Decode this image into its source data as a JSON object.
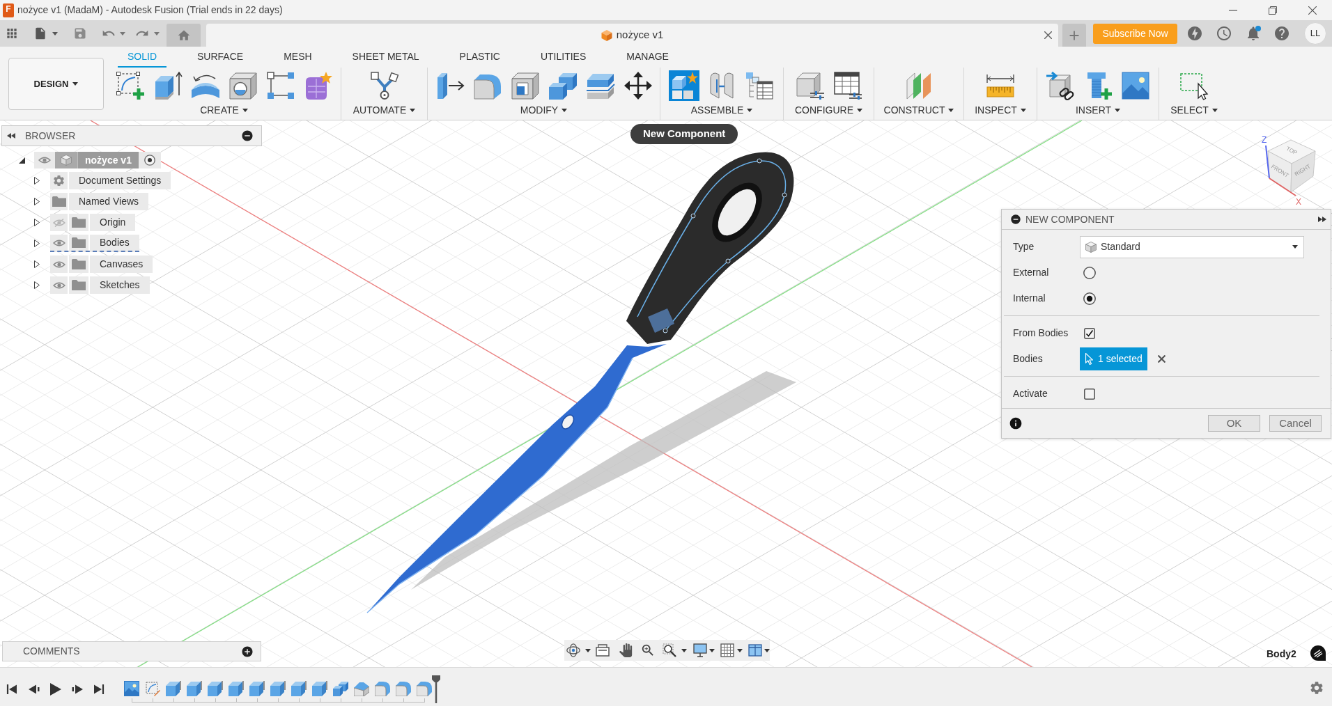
{
  "window": {
    "logo_letter": "F",
    "title": "nożyce v1 (MadaM) - Autodesk Fusion (Trial ends in 22 days)"
  },
  "tab_bar": {
    "document_title": "nożyce v1",
    "subscribe_button": "Subscribe Now",
    "unread_notifications": true,
    "avatar": "LL"
  },
  "toolbar": {
    "workspace": "DESIGN",
    "tabs": [
      {
        "label": "SOLID",
        "selected": true
      },
      {
        "label": "SURFACE",
        "selected": false
      },
      {
        "label": "MESH",
        "selected": false
      },
      {
        "label": "SHEET METAL",
        "selected": false
      },
      {
        "label": "PLASTIC",
        "selected": false
      },
      {
        "label": "UTILITIES",
        "selected": false
      },
      {
        "label": "MANAGE",
        "selected": false
      }
    ],
    "groups": [
      {
        "label": "CREATE",
        "tools": [
          {
            "kind": "sketch",
            "active": false
          },
          {
            "kind": "extrude",
            "active": false
          },
          {
            "kind": "revolve",
            "active": false
          },
          {
            "kind": "hole",
            "active": false
          },
          {
            "kind": "pattern",
            "active": false
          },
          {
            "kind": "form",
            "active": false
          }
        ]
      },
      {
        "label": "AUTOMATE",
        "tools": [
          {
            "kind": "automate",
            "active": false
          }
        ]
      },
      {
        "label": "MODIFY",
        "tools": [
          {
            "kind": "presspull",
            "active": false
          },
          {
            "kind": "fillet",
            "active": false
          },
          {
            "kind": "shell",
            "active": false
          },
          {
            "kind": "combine",
            "active": false
          },
          {
            "kind": "split",
            "active": false
          },
          {
            "kind": "move",
            "active": false
          }
        ]
      },
      {
        "label": "ASSEMBLE",
        "tools": [
          {
            "kind": "component",
            "active": true
          },
          {
            "kind": "joint",
            "active": false
          },
          {
            "kind": "table",
            "active": false
          }
        ]
      },
      {
        "label": "CONFIGURE",
        "tools": [
          {
            "kind": "configure",
            "active": false
          },
          {
            "kind": "parameters",
            "active": false
          }
        ]
      },
      {
        "label": "CONSTRUCT",
        "tools": [
          {
            "kind": "plane",
            "active": false
          }
        ]
      },
      {
        "label": "INSPECT",
        "tools": [
          {
            "kind": "measure",
            "active": false
          }
        ]
      },
      {
        "label": "INSERT",
        "tools": [
          {
            "kind": "derive",
            "active": false
          },
          {
            "kind": "fastener",
            "active": false
          },
          {
            "kind": "canvas",
            "active": false
          }
        ]
      },
      {
        "label": "SELECT",
        "tools": [
          {
            "kind": "select",
            "active": false
          }
        ]
      }
    ]
  },
  "tooltip": "New Component",
  "browser": {
    "title": "BROWSER",
    "root": {
      "name": "nożyce v1",
      "expanded": true,
      "visible": true,
      "active": true,
      "children": [
        {
          "name": "Document Settings",
          "kind": "settings",
          "expanded": false,
          "selected": false
        },
        {
          "name": "Named Views",
          "kind": "views",
          "expanded": false,
          "selected": false
        },
        {
          "name": "Origin",
          "kind": "folder",
          "visible": false,
          "expanded": false,
          "selected": false
        },
        {
          "name": "Bodies",
          "kind": "folder",
          "visible": true,
          "expanded": false,
          "selected": true
        },
        {
          "name": "Canvases",
          "kind": "folder",
          "visible": true,
          "expanded": false,
          "selected": false
        },
        {
          "name": "Sketches",
          "kind": "folder",
          "visible": true,
          "expanded": false,
          "selected": false
        }
      ]
    }
  },
  "view_cube": {
    "faces": [
      "TOP",
      "FRONT",
      "RIGHT"
    ],
    "axes": [
      "Z",
      "X"
    ]
  },
  "dialog": {
    "title": "NEW COMPONENT",
    "sections": [
      {
        "rows": [
          {
            "kind": "dropdown",
            "label": "Type",
            "value": "Standard"
          },
          {
            "kind": "radio",
            "label": "External",
            "selected": false
          },
          {
            "kind": "radio",
            "label": "Internal",
            "selected": true
          }
        ]
      },
      {
        "rows": [
          {
            "kind": "checkbox",
            "label": "From Bodies",
            "checked": true
          },
          {
            "kind": "selection",
            "label": "Bodies",
            "value": "1 selected"
          }
        ]
      },
      {
        "rows": [
          {
            "kind": "checkbox",
            "label": "Activate",
            "checked": false
          }
        ]
      }
    ],
    "buttons": [
      "OK",
      "Cancel"
    ]
  },
  "comments": {
    "title": "COMMENTS"
  },
  "status": {
    "selection": "Body2"
  }
}
